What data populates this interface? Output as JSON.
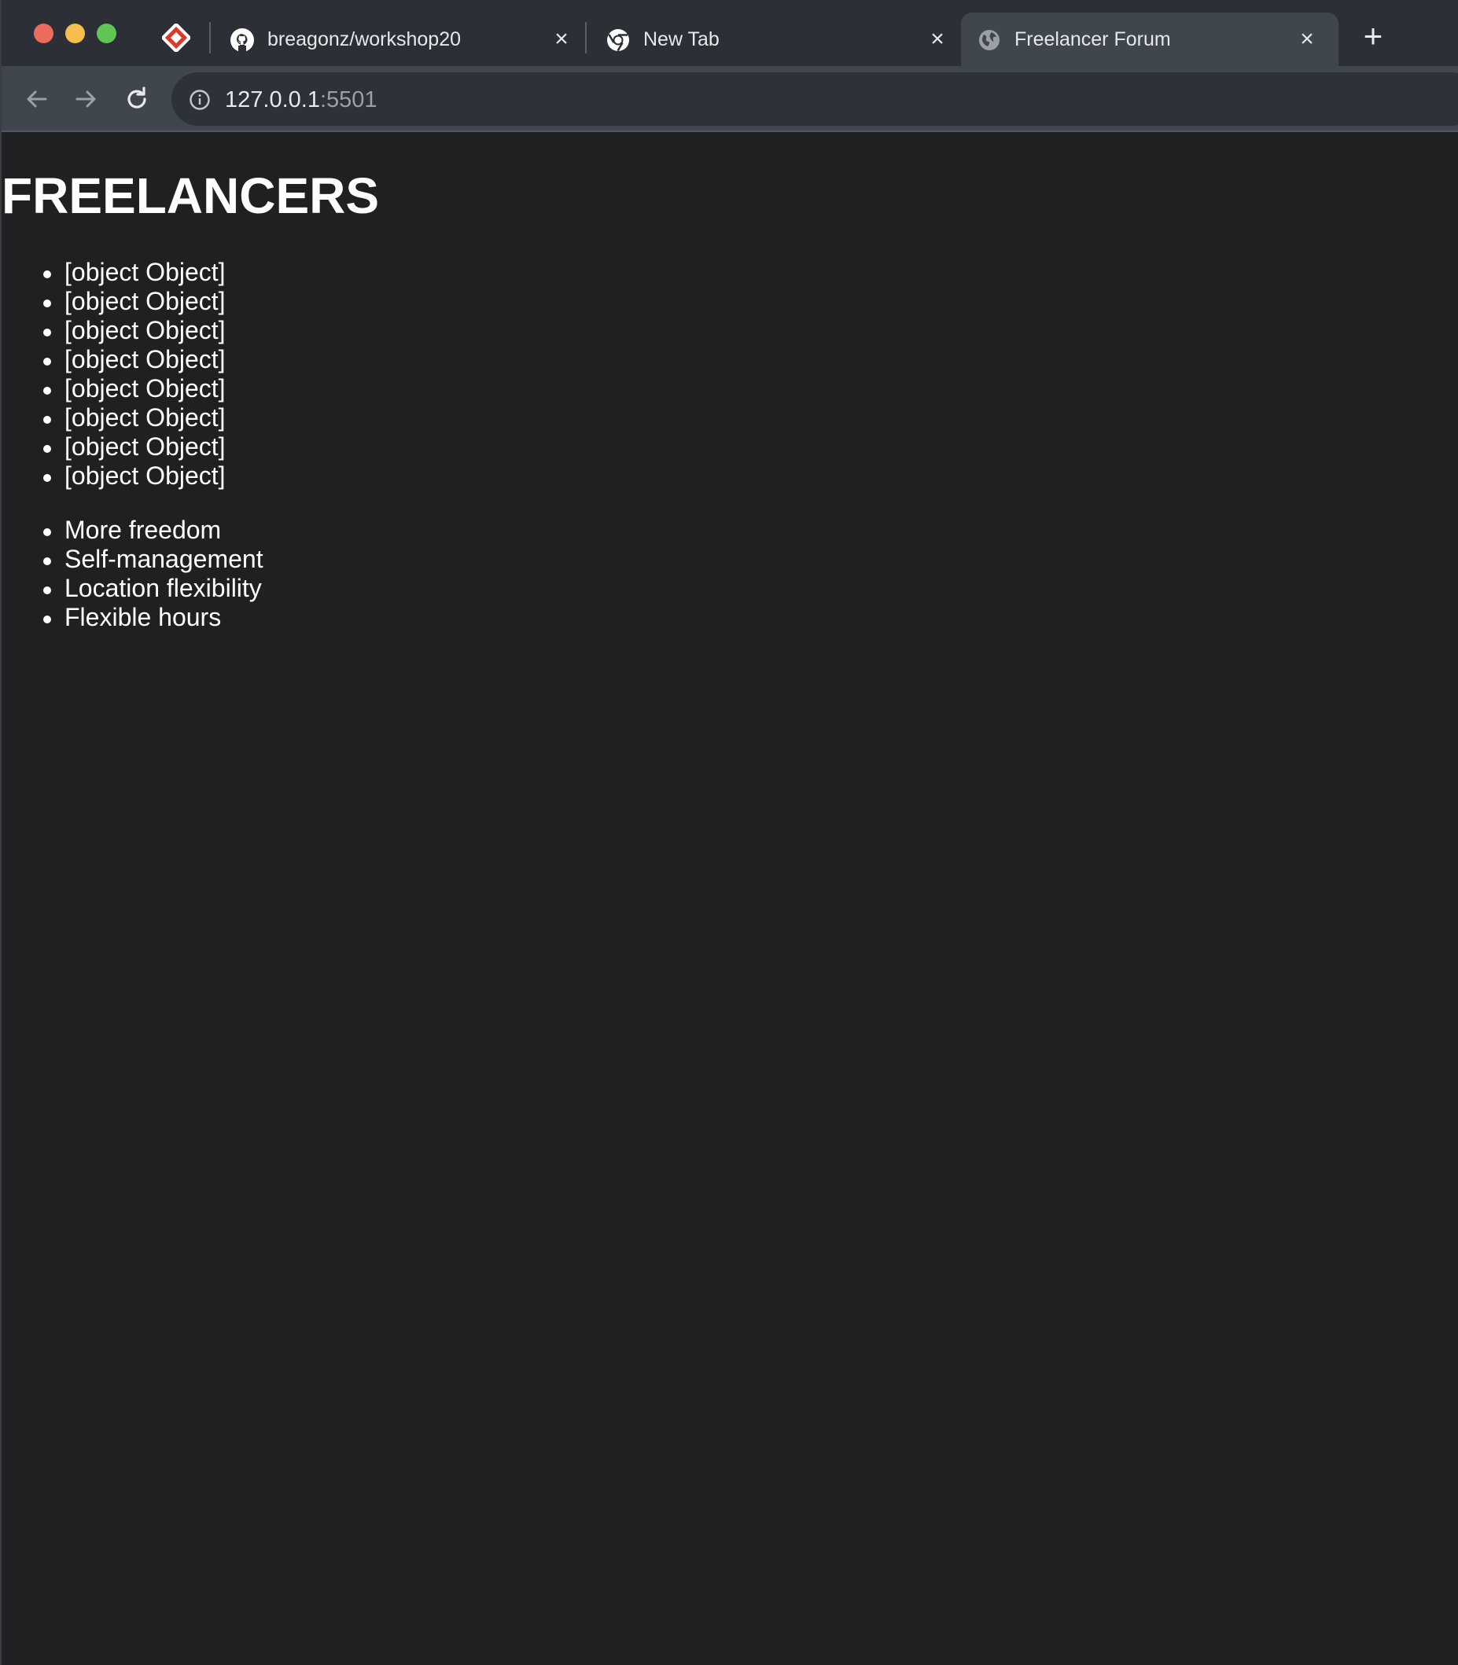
{
  "browser": {
    "tabs": [
      {
        "title": "breagonz/workshop20",
        "icon": "github-icon"
      },
      {
        "title": "New Tab",
        "icon": "chrome-icon"
      },
      {
        "title": "Freelancer Forum",
        "icon": "globe-icon",
        "active": true
      }
    ],
    "address": {
      "host": "127.0.0.1",
      "port": ":5501"
    }
  },
  "page": {
    "heading": "FREELANCERS",
    "freelancers": [
      "[object Object]",
      "[object Object]",
      "[object Object]",
      "[object Object]",
      "[object Object]",
      "[object Object]",
      "[object Object]",
      "[object Object]"
    ],
    "benefits": [
      "More freedom",
      "Self-management",
      "Location flexibility",
      "Flexible hours"
    ]
  },
  "colors": {
    "page_background": "#1f2022",
    "tab_strip": "#2c3036",
    "toolbar": "#3f464e",
    "text": "#ffffff"
  }
}
